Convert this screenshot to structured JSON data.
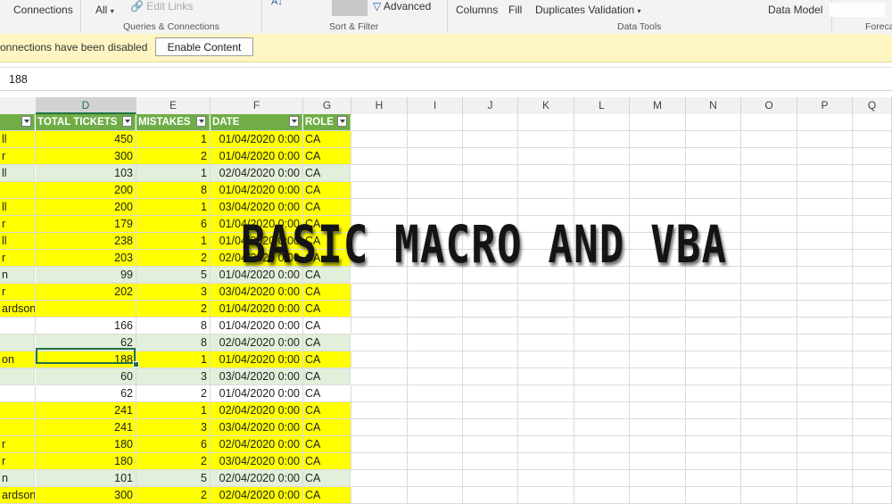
{
  "ribbon": {
    "connections_label": "Connections",
    "all_label": "All",
    "edit_links_label": "Edit Links",
    "advanced_label": "Advanced",
    "columns_label": "Columns",
    "fill_label": "Fill",
    "duplicates_validation_label": "Duplicates Validation",
    "data_model_label": "Data Model",
    "groups": {
      "queries": "Queries & Connections",
      "sort_filter": "Sort & Filter",
      "data_tools": "Data Tools",
      "forecast": "Foreca"
    }
  },
  "message_bar": {
    "text": "onnections have been disabled",
    "button_label": "Enable Content"
  },
  "formula_bar": {
    "value": "188"
  },
  "columns": [
    "D",
    "E",
    "F",
    "G",
    "H",
    "I",
    "J",
    "K",
    "L",
    "M",
    "N",
    "O",
    "P",
    "Q"
  ],
  "table": {
    "headers": {
      "total_tickets": "TOTAL TICKETS",
      "mistakes": "MISTAKES",
      "date": "DATE",
      "role": "ROLE"
    },
    "rows": [
      {
        "name": "ll",
        "tickets": "450",
        "mistakes": "1",
        "date": "01/04/2020 0:00",
        "role": "CA",
        "color": "yellow"
      },
      {
        "name": "r",
        "tickets": "300",
        "mistakes": "2",
        "date": "01/04/2020 0:00",
        "role": "CA",
        "color": "yellow"
      },
      {
        "name": "ll",
        "tickets": "103",
        "mistakes": "1",
        "date": "02/04/2020 0:00",
        "role": "CA",
        "color": "green"
      },
      {
        "name": "",
        "tickets": "200",
        "mistakes": "8",
        "date": "01/04/2020 0:00",
        "role": "CA",
        "color": "yellow"
      },
      {
        "name": "ll",
        "tickets": "200",
        "mistakes": "1",
        "date": "03/04/2020 0:00",
        "role": "CA",
        "color": "yellow"
      },
      {
        "name": "r",
        "tickets": "179",
        "mistakes": "6",
        "date": "01/04/2020 0:00",
        "role": "CA",
        "color": "yellow"
      },
      {
        "name": "ll",
        "tickets": "238",
        "mistakes": "1",
        "date": "01/04/2020 0:00",
        "role": "CA",
        "color": "yellow"
      },
      {
        "name": "r",
        "tickets": "203",
        "mistakes": "2",
        "date": "02/04/2020 0:00",
        "role": "CA",
        "color": "yellow"
      },
      {
        "name": "n",
        "tickets": "99",
        "mistakes": "5",
        "date": "01/04/2020 0:00",
        "role": "CA",
        "color": "green"
      },
      {
        "name": "r",
        "tickets": "202",
        "mistakes": "3",
        "date": "03/04/2020 0:00",
        "role": "CA",
        "color": "yellow"
      },
      {
        "name": "ardson",
        "tickets": "",
        "mistakes": "2",
        "date": "01/04/2020 0:00",
        "role": "CA",
        "color": "yellow"
      },
      {
        "name": "",
        "tickets": "166",
        "mistakes": "8",
        "date": "01/04/2020 0:00",
        "role": "CA",
        "color": "white"
      },
      {
        "name": "",
        "tickets": "62",
        "mistakes": "8",
        "date": "02/04/2020 0:00",
        "role": "CA",
        "color": "green"
      },
      {
        "name": "on",
        "tickets": "188",
        "mistakes": "1",
        "date": "01/04/2020 0:00",
        "role": "CA",
        "color": "yellow"
      },
      {
        "name": "",
        "tickets": "60",
        "mistakes": "3",
        "date": "03/04/2020 0:00",
        "role": "CA",
        "color": "green"
      },
      {
        "name": "",
        "tickets": "62",
        "mistakes": "2",
        "date": "01/04/2020 0:00",
        "role": "CA",
        "color": "white"
      },
      {
        "name": "",
        "tickets": "241",
        "mistakes": "1",
        "date": "02/04/2020 0:00",
        "role": "CA",
        "color": "yellow"
      },
      {
        "name": "",
        "tickets": "241",
        "mistakes": "3",
        "date": "03/04/2020 0:00",
        "role": "CA",
        "color": "yellow"
      },
      {
        "name": "r",
        "tickets": "180",
        "mistakes": "6",
        "date": "02/04/2020 0:00",
        "role": "CA",
        "color": "yellow"
      },
      {
        "name": "r",
        "tickets": "180",
        "mistakes": "2",
        "date": "03/04/2020 0:00",
        "role": "CA",
        "color": "yellow"
      },
      {
        "name": "n",
        "tickets": "101",
        "mistakes": "5",
        "date": "02/04/2020 0:00",
        "role": "CA",
        "color": "green"
      },
      {
        "name": "ardson",
        "tickets": "300",
        "mistakes": "2",
        "date": "02/04/2020 0:00",
        "role": "CA",
        "color": "yellow"
      }
    ]
  },
  "overlay_title": "BASIC MACRO AND VBA",
  "colors": {
    "header_green": "#70ad47",
    "highlight_yellow": "#ffff00",
    "band_green": "#e2efda",
    "excel_green": "#217346"
  }
}
